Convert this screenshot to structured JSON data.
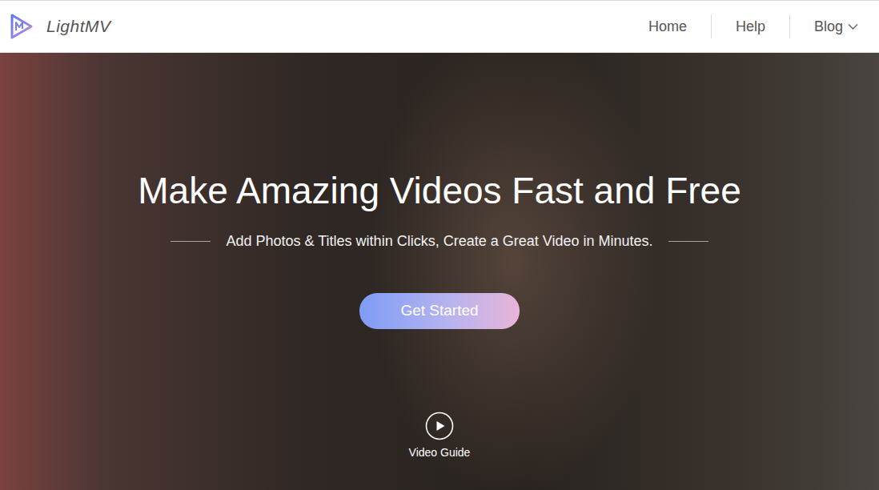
{
  "header": {
    "logo": "LightMV",
    "nav": [
      {
        "label": "Home",
        "menu": false
      },
      {
        "label": "Help",
        "menu": false
      },
      {
        "label": "Blog",
        "menu": true
      }
    ]
  },
  "hero": {
    "title": "Make Amazing Videos Fast and Free",
    "subtitle": "Add Photos & Titles within Clicks, Create a Great Video in Minutes.",
    "button": "Get Started",
    "guide": "Video Guide"
  }
}
